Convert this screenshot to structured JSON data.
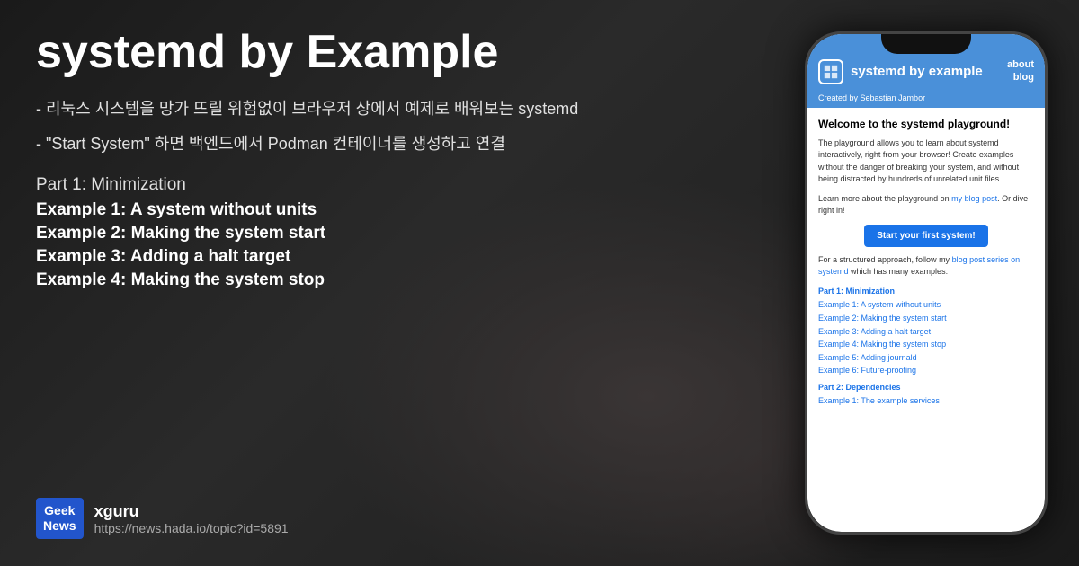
{
  "background": {
    "color": "#1a1a1a"
  },
  "left": {
    "title": "systemd by Example",
    "description1": "- 리눅스 시스템을 망가 뜨릴 위험없이 브라우저 상에서 예제로 배워보는 systemd",
    "description2": "- \"Start System\" 하면 백엔드에서 Podman 컨테이너를 생성하고 연결",
    "part1_label": "Part 1: Minimization",
    "examples": [
      "Example 1: A system without units",
      "Example 2: Making the system start",
      "Example 3: Adding a halt target",
      "Example 4: Making the system stop"
    ],
    "badge_line1": "Geek",
    "badge_line2": "News",
    "source_name": "xguru",
    "source_url": "https://news.hada.io/topic?id=5891"
  },
  "phone": {
    "header": {
      "app_title": "systemd by example",
      "nav_about": "about",
      "nav_blog": "blog",
      "creator": "Created by Sebastian Jambor"
    },
    "body": {
      "welcome_title": "Welcome to the systemd playground!",
      "description": "The playground allows you to learn about systemd interactively, right from your browser! Create examples without the danger of breaking your system, and without being distracted by hundreds of unrelated unit files.",
      "learn_text": "Learn more about the playground on ",
      "learn_link": "my blog post",
      "dive_text": ". Or dive right in!",
      "start_button": "Start your first system!",
      "structured_text": "For a structured approach, follow my ",
      "blog_series_link": "blog post series on systemd",
      "structured_text2": " which has many examples:",
      "part1_label": "Part 1: Minimization",
      "examples_part1": [
        {
          "prefix": "Example 1: ",
          "link": "A system without units"
        },
        {
          "prefix": "Example 2: ",
          "link": "Making the system start"
        },
        {
          "prefix": "Example 3: ",
          "link": "Adding a halt target"
        },
        {
          "prefix": "Example 4: ",
          "link": "Making the system stop"
        },
        {
          "prefix": "Example 5: ",
          "link": "Adding journald"
        },
        {
          "prefix": "Example 6: ",
          "link": "Future-proofing"
        }
      ],
      "part2_label": "Part 2: Dependencies",
      "part2_example": "Example 1: The example services"
    }
  }
}
